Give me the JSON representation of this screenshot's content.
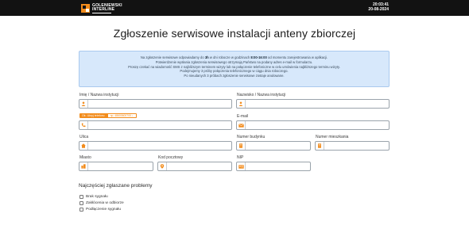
{
  "header": {
    "logo_line1": "GOLENIEWSKI",
    "logo_line2": "INTERLINE",
    "time": "20:03:41",
    "date": "20-08-2024",
    "bg_color": "#121212",
    "accent_color": "#f28c1c"
  },
  "page_title": "Zgłoszenie serwisowe instalacji anteny zbiorczej",
  "info": {
    "line1_a": "Na zgłoszenie serwisowe odpowiadamy do ",
    "line1_b": "3h",
    "line1_c": " w dni robocze w godzinach ",
    "line1_d": "8:00-16:00",
    "line1_e": " od momentu zarejestrowania w aplikacji.",
    "line2": "Potwierdzenie wysłania zgłoszenia serwisowego otrzymają Państwo na podany adres e-mail w formularzu.",
    "line3": "Proszę czekać na wiadomość SMS z najbliższym terminem wizyty lub na połączenie telefoniczne w celu umówienia najbliższego terminu wizyty.",
    "line4": "Podejmujemy 3 próby połączenia telefonicznego w ciągu dnia roboczego.",
    "line5": "Po nieudanych 3 próbach zgłoszenie serwisowe zostaje anulowane.",
    "bg_color": "#d7e8fb"
  },
  "form": {
    "name_label": "Imię / Nazwa instytucji",
    "surname_label": "Nazwisko / Nazwa instytucji",
    "phone_badge": "Ok. Ukryj telefonu",
    "phone_badge_hint": "np. 48600600700 ↓",
    "email_label": "E-mail",
    "street_label": "Ulica",
    "building_label": "Numer budynku",
    "apartment_label": "Numer mieszkania",
    "city_label": "Miasto",
    "postal_label": "Kod pocztowy",
    "nip_label": "NIP"
  },
  "problems": {
    "heading": "Najczęściej zgłaszane problemy",
    "items": [
      "Brak sygnału",
      "Zakłócenia w odbiorze",
      "Podłączenie sygnału"
    ]
  },
  "icons": {
    "person": "person-icon",
    "phone": "phone-icon",
    "email": "email-icon",
    "home": "home-icon",
    "building": "building-icon",
    "city": "building-icon",
    "postal": "postal-icon",
    "nip": "id-card-icon"
  }
}
